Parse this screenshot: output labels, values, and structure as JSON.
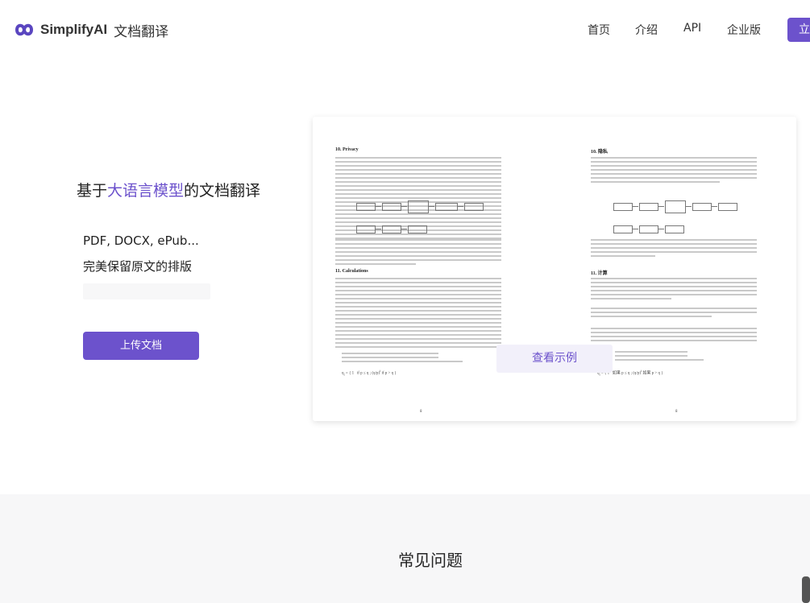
{
  "header": {
    "brand": "SimplifyAI",
    "brand_sub": "文档翻译",
    "nav": [
      "首页",
      "介绍",
      "API",
      "企业版"
    ],
    "cta_label": "立"
  },
  "hero": {
    "title_prefix": "基于",
    "title_highlight": "大语言模型",
    "title_suffix": "的文档翻译",
    "feature_1": "PDF, DOCX, ePub...",
    "feature_2": "完美保留原文的排版",
    "upload_label": "上传文档"
  },
  "preview": {
    "left_heading_1": "10.  Privacy",
    "left_heading_2": "11.  Calculations",
    "right_heading_1": "10. 隐私",
    "right_heading_2": "11. 计算",
    "left_page_number": "8",
    "right_page_number": "8",
    "example_label": "查看示例"
  },
  "faq": {
    "title": "常见问题"
  },
  "colors": {
    "accent": "#6c52cc",
    "light_accent": "#f2f0fa",
    "faq_bg": "#f7f7f8"
  }
}
